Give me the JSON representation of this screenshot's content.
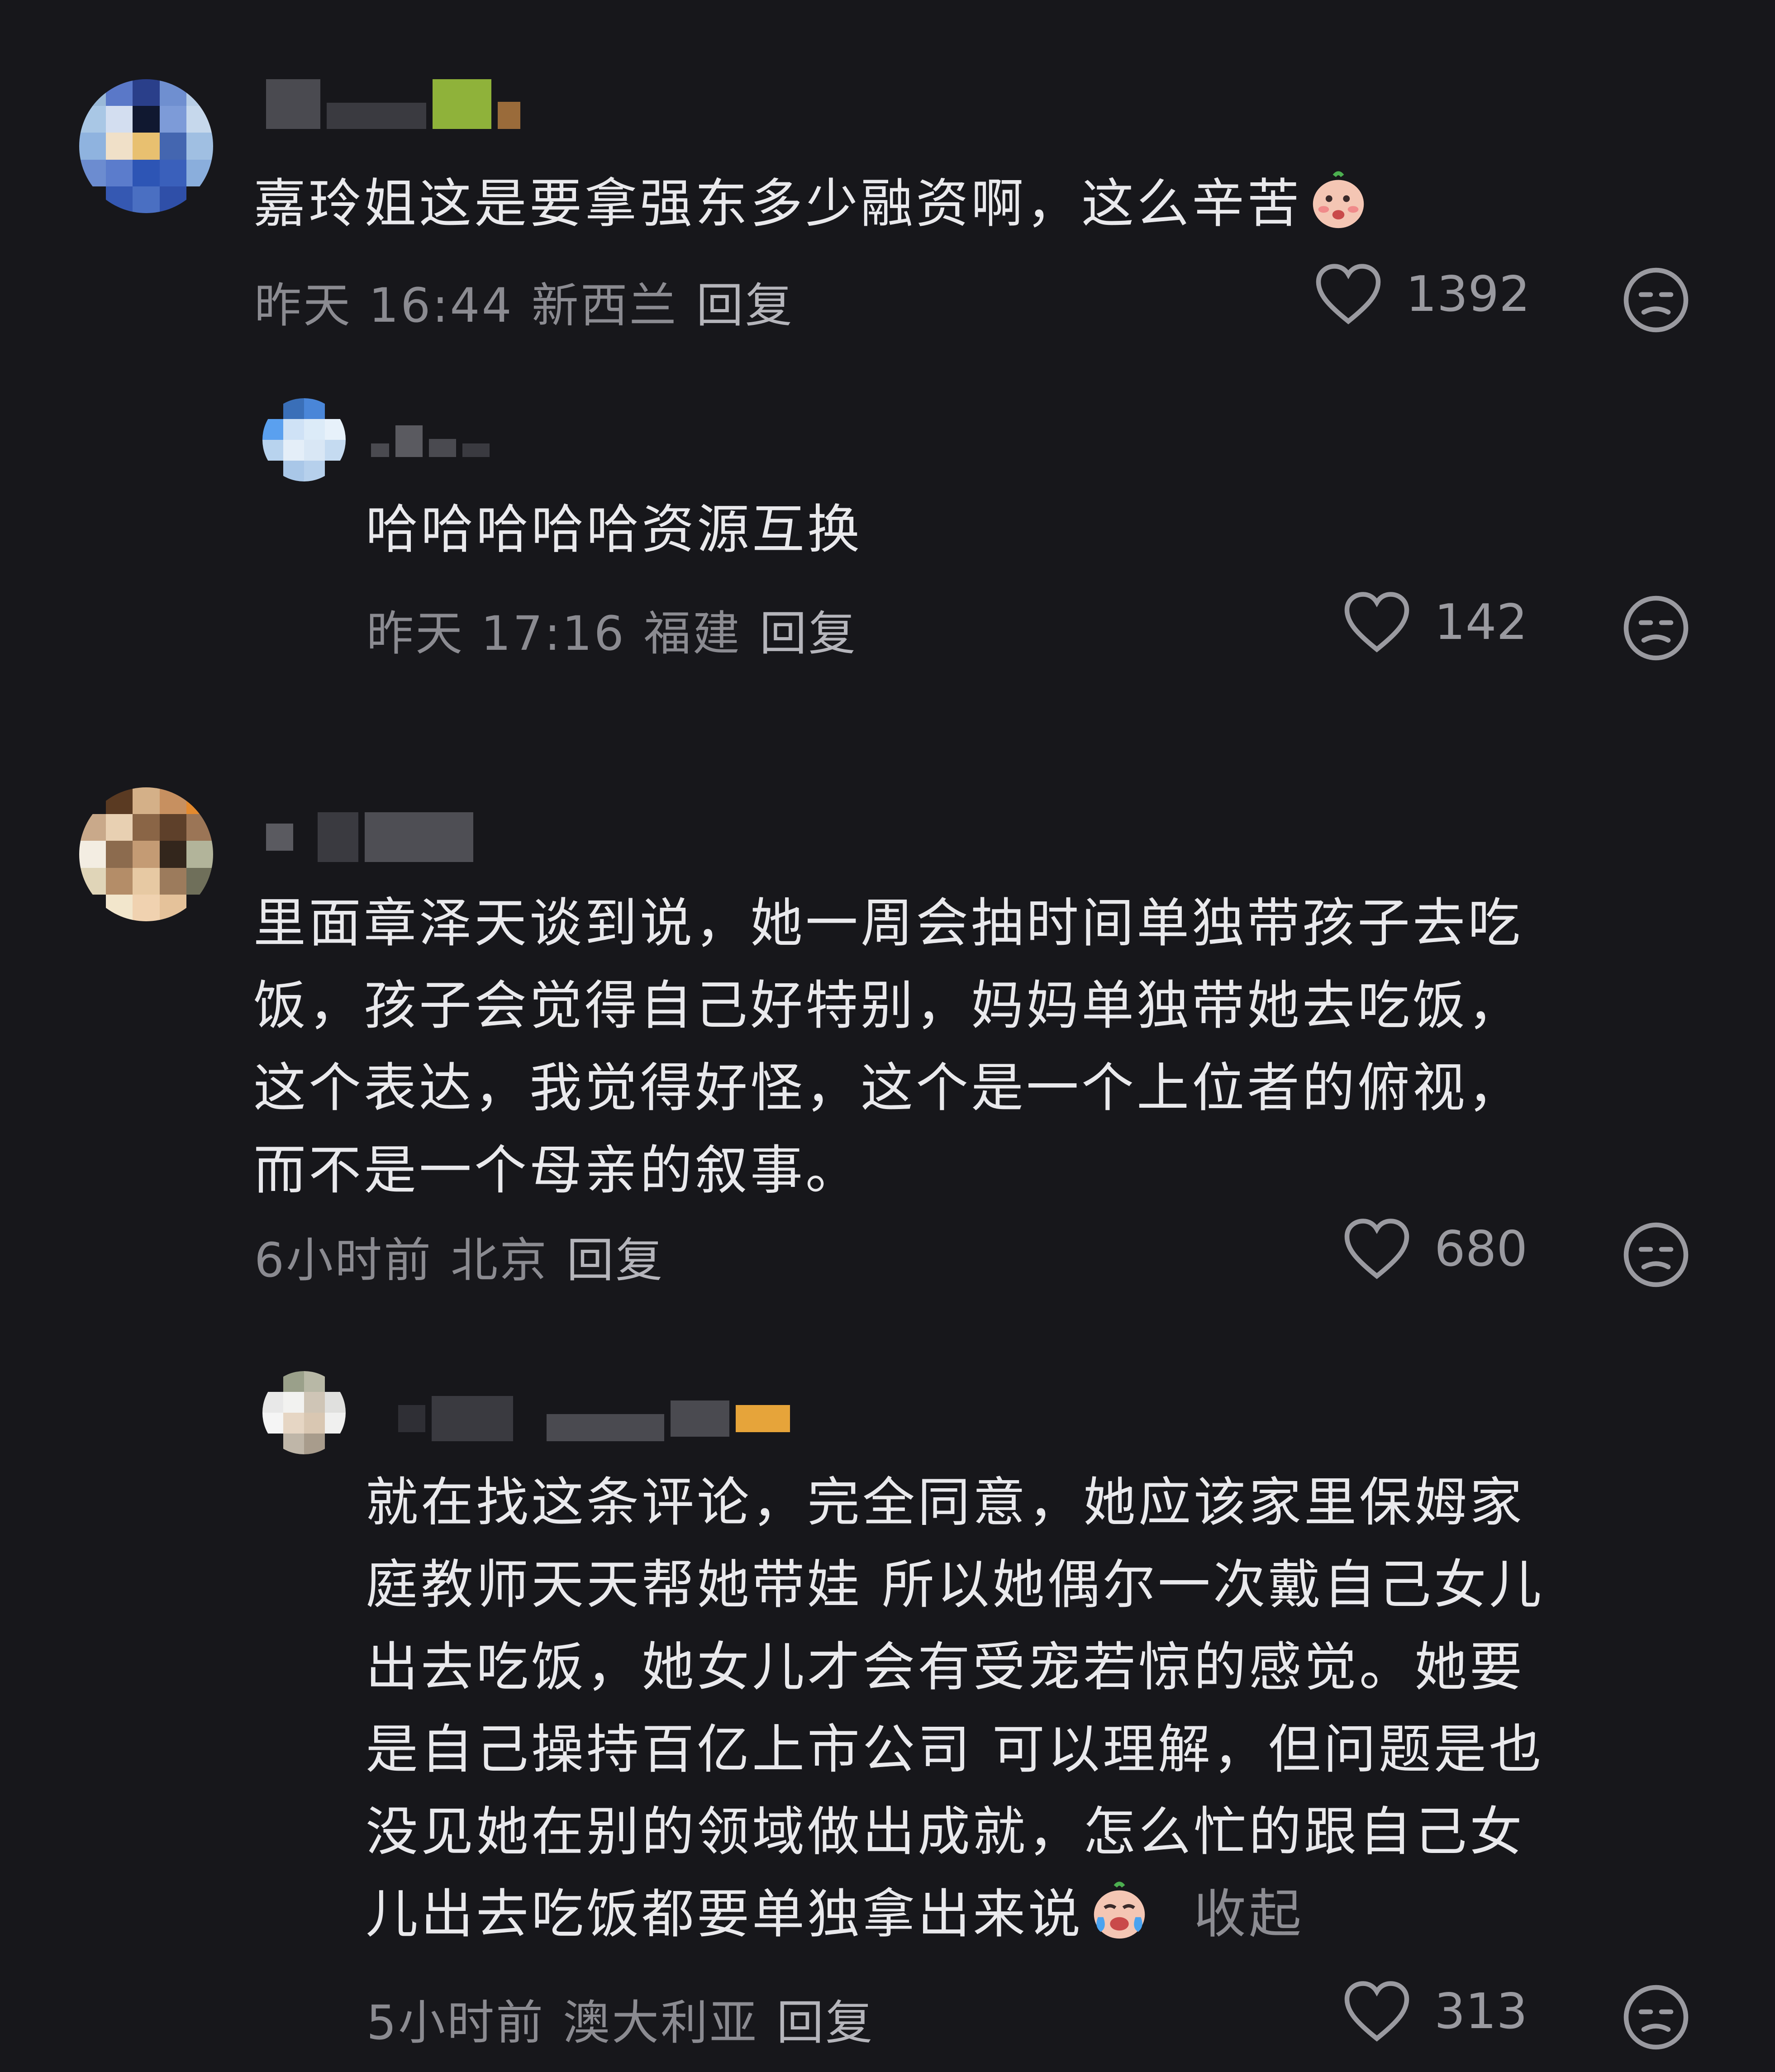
{
  "comments": [
    {
      "text": "嘉玲姐这是要拿强东多少融资啊，这么辛苦",
      "emoji_icon": "shy-face-emoji-icon",
      "time": "昨天 16:44",
      "location": "新西兰",
      "reply_label": "回复",
      "likes": "1392"
    },
    {
      "text": "哈哈哈哈哈资源互换",
      "time": "昨天 17:16",
      "location": "福建",
      "reply_label": "回复",
      "likes": "142"
    },
    {
      "text": "里面章泽天谈到说，她一周会抽时间单独带孩子去吃\n饭，孩子会觉得自己好特别，妈妈单独带她去吃饭，\n这个表达，我觉得好怪，这个是一个上位者的俯视，\n而不是一个母亲的叙事。",
      "time": "6小时前",
      "location": "北京",
      "reply_label": "回复",
      "likes": "680"
    },
    {
      "text": "就在找这条评论，完全同意，她应该家里保姆家\n庭教师天天帮她带娃 所以她偶尔一次戴自己女儿\n出去吃饭，她女儿才会有受宠若惊的感觉。她要\n是自己操持百亿上市公司 可以理解，但问题是也\n没见她在别的领域做出成就，怎么忙的跟自己女\n儿出去吃饭都要单独拿出来说",
      "emoji_icon": "crying-face-emoji-icon",
      "collapse_label": "收起",
      "time": "5小时前",
      "location": "澳大利亚",
      "reply_label": "回复",
      "likes": "313"
    }
  ],
  "icons": {
    "like": "heart-outline-icon",
    "dislike": "unhappy-face-icon"
  },
  "colors": {
    "background": "#17171b",
    "text": "#e9e9ec",
    "meta": "#8b8b91"
  }
}
